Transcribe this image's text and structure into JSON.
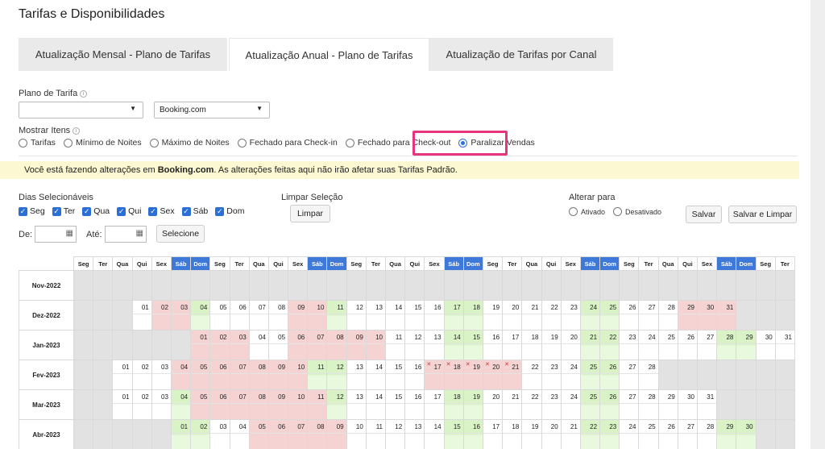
{
  "title": "Tarifas e Disponibilidades",
  "tabs": [
    {
      "label": "Atualização Mensal - Plano de Tarifas",
      "active": false
    },
    {
      "label": "Atualização Anual - Plano de Tarifas",
      "active": true
    },
    {
      "label": "Atualização de Tarifas por Canal",
      "active": false
    }
  ],
  "rate_plan": {
    "label": "Plano de Tarifa",
    "plan_value": "",
    "channel_value": "Booking.com"
  },
  "show_items": {
    "label": "Mostrar Itens",
    "options": [
      "Tarifas",
      "Mínimo de Noites",
      "Máximo de Noites",
      "Fechado para Check-in",
      "Fechado para Check-out",
      "Paralizar Vendas"
    ],
    "selected": "Paralizar Vendas"
  },
  "notice": {
    "prefix": "Você está fazendo alterações em ",
    "channel": "Booking.com",
    "suffix": ". As alterações feitas aqui não irão afetar suas Tarifas Padrão."
  },
  "selectable_days": {
    "label": "Dias Selecionáveis",
    "days": [
      "Seg",
      "Ter",
      "Qua",
      "Qui",
      "Sex",
      "Sáb",
      "Dom"
    ]
  },
  "clear_selection": {
    "label": "Limpar Seleção",
    "button": "Limpar"
  },
  "change_to": {
    "label": "Alterar para",
    "options": [
      "Ativado",
      "Desativado"
    ],
    "save": "Salvar",
    "save_clear": "Salvar e Limpar"
  },
  "date_range": {
    "from_label": "De:",
    "to_label": "Até:",
    "select_button": "Selecione"
  },
  "weekday_headers": [
    "Seg",
    "Ter",
    "Qua",
    "Qui",
    "Sex",
    "Sáb",
    "Dom",
    "Seg",
    "Ter",
    "Qua",
    "Qui",
    "Sex",
    "Sáb",
    "Dom",
    "Seg",
    "Ter",
    "Qua",
    "Qui",
    "Sex",
    "Sáb",
    "Dom",
    "Seg",
    "Ter",
    "Qua",
    "Qui",
    "Sex",
    "Sáb",
    "Dom",
    "Seg",
    "Ter",
    "Qua",
    "Qui",
    "Sex",
    "Sáb",
    "Dom",
    "Seg",
    "Ter"
  ],
  "months": [
    {
      "label": "Nov-2022",
      "start": 21,
      "days": 30,
      "shown_from": 23,
      "pink": []
    },
    {
      "label": "Dez-2022",
      "start": 3,
      "days": 31,
      "shown_from": 1,
      "pink": [
        2,
        3,
        9,
        10,
        29,
        30,
        31
      ]
    },
    {
      "label": "Jan-2023",
      "start": 6,
      "days": 31,
      "shown_from": 1,
      "pink": [
        1,
        2,
        3,
        6,
        7,
        8,
        9,
        10
      ]
    },
    {
      "label": "Fev-2023",
      "start": 2,
      "days": 28,
      "shown_from": 1,
      "pink": [
        4,
        5,
        6,
        7,
        8,
        9,
        10,
        17,
        18,
        19,
        20,
        21
      ],
      "marked": [
        17,
        18,
        19,
        20,
        21
      ]
    },
    {
      "label": "Mar-2023",
      "start": 2,
      "days": 31,
      "shown_from": 1,
      "pink": [
        5,
        6,
        7,
        8,
        9,
        10,
        11
      ]
    },
    {
      "label": "Abr-2023",
      "start": 5,
      "days": 30,
      "shown_from": 1,
      "pink": [
        5,
        6,
        7,
        8,
        9
      ]
    }
  ]
}
